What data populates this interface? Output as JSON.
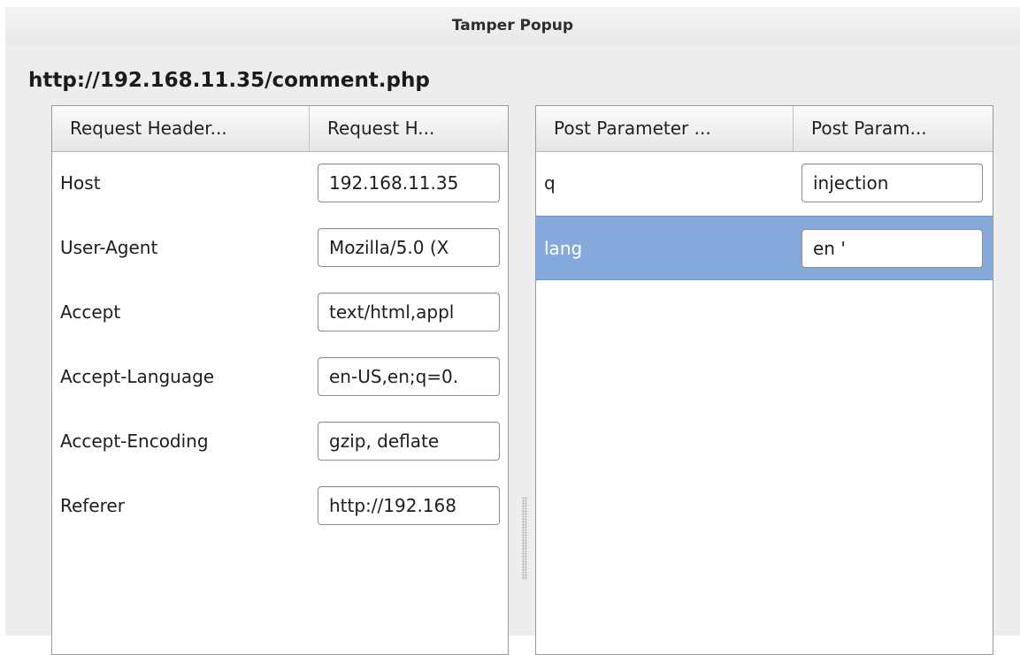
{
  "window": {
    "title": "Tamper Popup"
  },
  "url": "http://192.168.11.35/comment.php",
  "headers_table": {
    "columns": [
      "Request Header...",
      "Request H..."
    ],
    "rows": [
      {
        "name": "Host",
        "value": "192.168.11.35"
      },
      {
        "name": "User-Agent",
        "value": "Mozilla/5.0 (X"
      },
      {
        "name": "Accept",
        "value": "text/html,appl"
      },
      {
        "name": "Accept-Language",
        "value": "en-US,en;q=0."
      },
      {
        "name": "Accept-Encoding",
        "value": "gzip, deflate"
      },
      {
        "name": "Referer",
        "value": "http://192.168"
      }
    ]
  },
  "post_table": {
    "columns": [
      "Post Parameter ...",
      "Post Param..."
    ],
    "rows": [
      {
        "name": "q",
        "value": "injection"
      },
      {
        "name": "lang",
        "value": "en '",
        "selected": true
      }
    ]
  },
  "colors": {
    "selection": "#86a9dc",
    "window_bg": "#ededed",
    "panel_bg": "#ffffff"
  }
}
